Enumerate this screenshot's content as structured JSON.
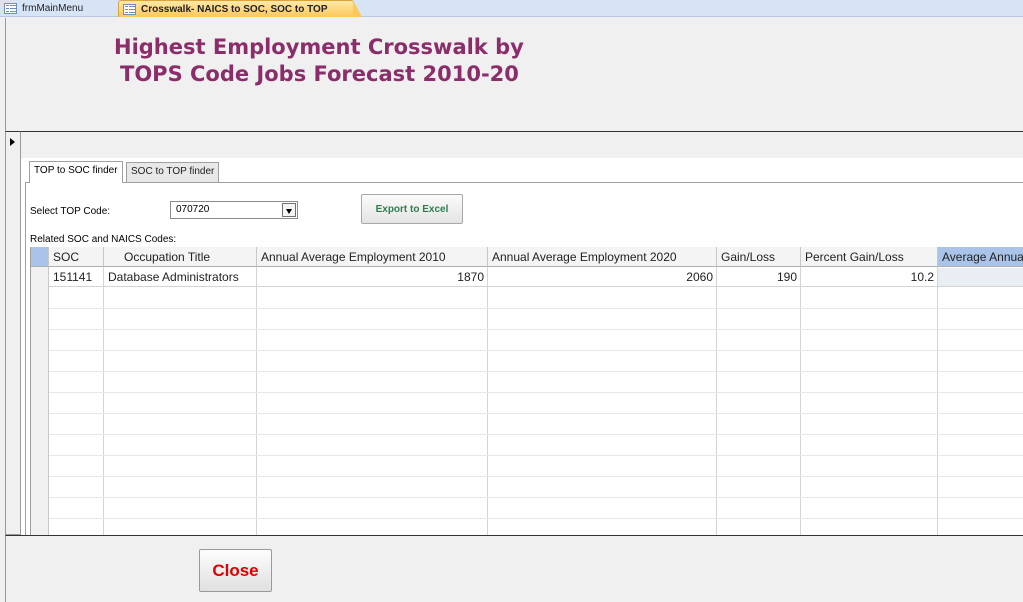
{
  "tabs": [
    {
      "label": "frmMainMenu"
    },
    {
      "label": "Crosswalk- NAICS to SOC, SOC to TOP"
    }
  ],
  "header": {
    "title_line1": "Highest Employment Crosswalk by",
    "title_line2": "TOPS Code Jobs Forecast 2010-20"
  },
  "tab_control": {
    "tabs": [
      "TOP to SOC finder",
      "SOC to TOP finder"
    ],
    "active": "TOP to SOC finder"
  },
  "finder": {
    "select_label": "Select TOP Code:",
    "top_code_value": "070720",
    "export_label": "Export to Excel",
    "related_label": "Related SOC and NAICS Codes:"
  },
  "grid": {
    "columns": [
      "SOC",
      "Occupation Title",
      "Annual Average Employment 2010",
      "Annual Average Employment 2020",
      "Gain/Loss",
      "Percent Gain/Loss",
      "Average Annual"
    ],
    "rows": [
      {
        "soc": "151141",
        "title": "Database Administrators",
        "emp2010": "1870",
        "emp2020": "2060",
        "gain": "190",
        "pct": "10.2",
        "avg": ""
      }
    ]
  },
  "footer": {
    "close_label": "Close"
  }
}
